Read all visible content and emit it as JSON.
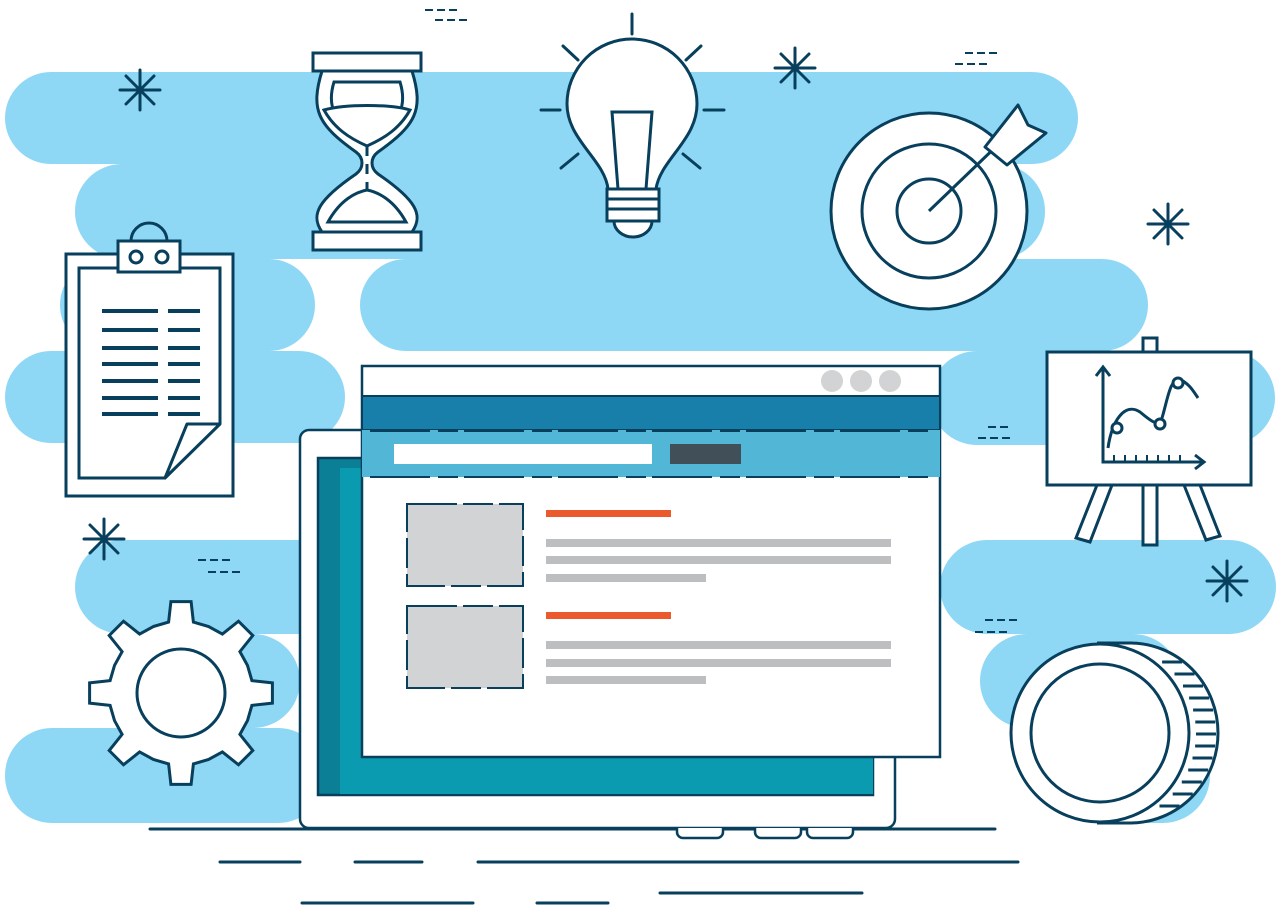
{
  "colors": {
    "background": "#ffffff",
    "cloud": "#8fd8f5",
    "stroke": "#073f5c",
    "browser_nav_bar": "#177fa9",
    "browser_search_bar": "#52b7d7",
    "search_button": "#414f59",
    "window_dots": "#d1d3d4",
    "thumbnail": "#d1d3d4",
    "headline_accent": "#ea5a2d",
    "text_placeholder": "#bcbec0",
    "laptop_screen": "#0a7f95",
    "laptop_screen_inner": "#0b9bb0",
    "laptop_body": "#ffffff"
  },
  "icons": [
    "clipboard-icon",
    "hourglass-icon",
    "lightbulb-icon",
    "target-icon",
    "presentation-chart-icon",
    "gear-icon",
    "coin-icon",
    "sparkle-icon"
  ],
  "browser": {
    "search": {
      "value": "",
      "placeholder": ""
    },
    "search_button_label": "",
    "results": [
      {
        "title": "",
        "snippet": ""
      },
      {
        "title": "",
        "snippet": ""
      }
    ]
  }
}
